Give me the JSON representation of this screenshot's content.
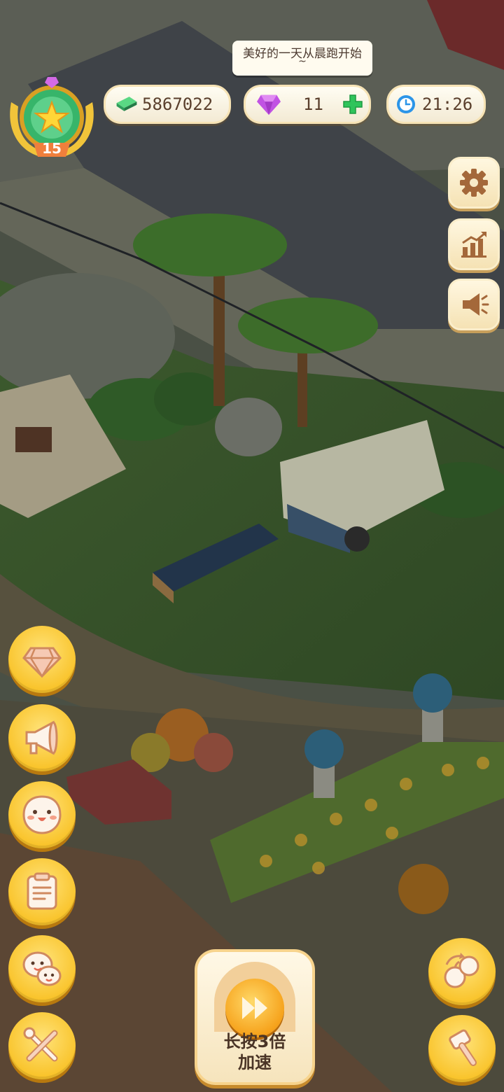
{
  "hud": {
    "level": "15",
    "cash": "5867022",
    "gems": "11",
    "clock": "21:26"
  },
  "speech_bubble": {
    "text": "美好的一天从晨跑开始",
    "tail": "~"
  },
  "speed_button": {
    "line1": "长按3倍",
    "line2": "加速"
  },
  "colors": {
    "gold_button": "#f9c42c",
    "cash_green": "#34b36a",
    "gem_purple": "#c153e3",
    "plus_green": "#2fc45b",
    "clock_blue": "#2c95e8"
  },
  "icons": {
    "left_column": [
      "diamond-icon",
      "megaphone-icon",
      "smiley-face-icon",
      "clipboard-icon",
      "chat-faces-icon",
      "tools-icon"
    ],
    "right_top": [
      "gear-icon",
      "stats-chart-icon",
      "announcement-icon"
    ],
    "right_bottom": [
      "fruit-swap-icon",
      "hammer-icon"
    ]
  }
}
